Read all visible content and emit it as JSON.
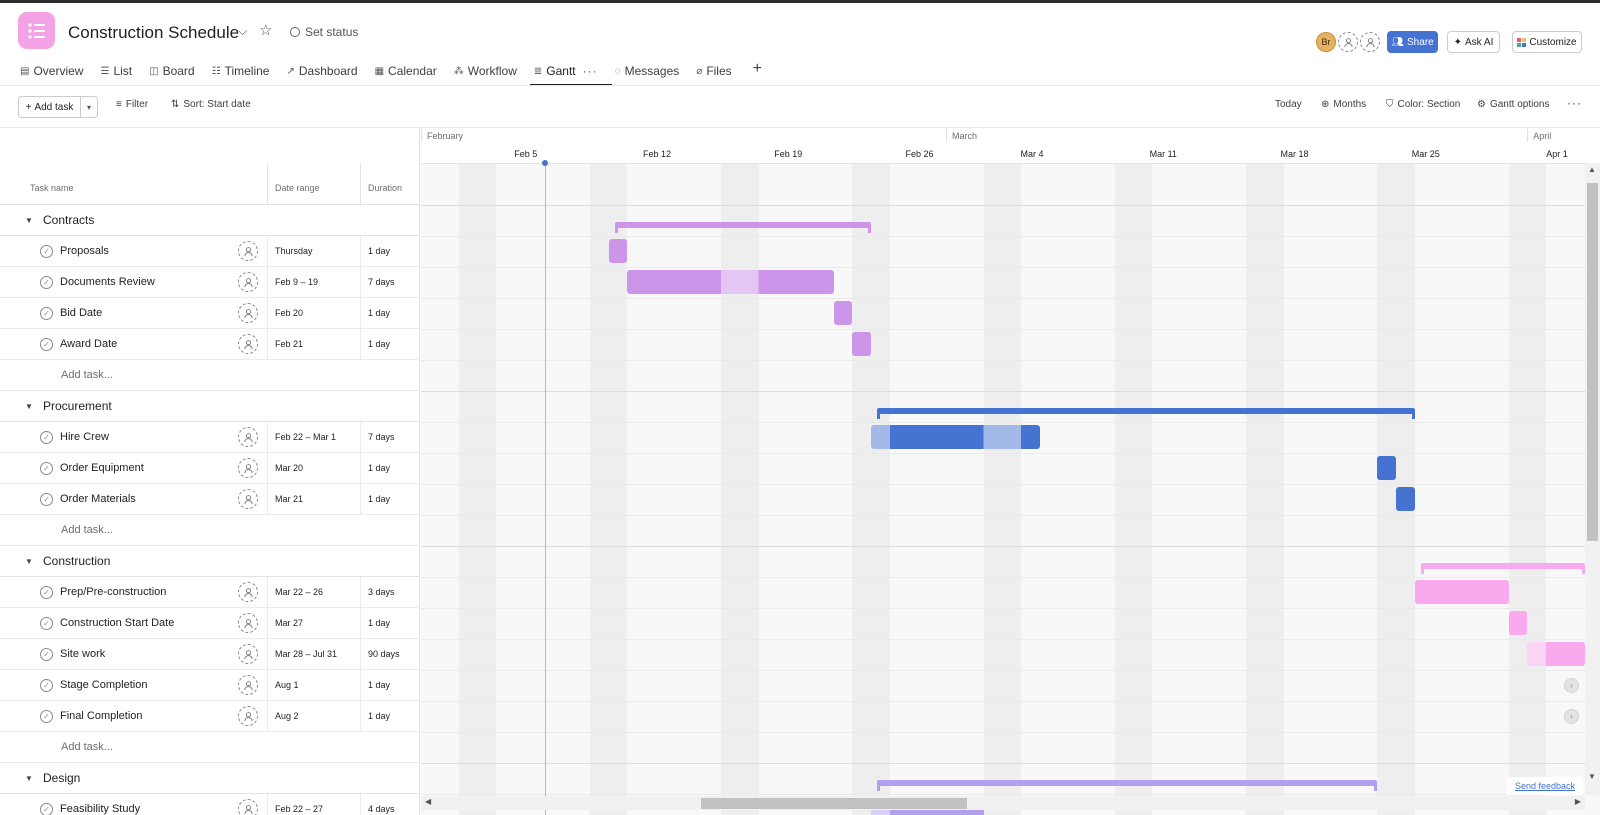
{
  "header": {
    "title": "Construction Schedule",
    "set_status": "Set status",
    "avatar_initials": "Br",
    "share_label": "Share",
    "ask_ai_label": "Ask AI",
    "customize_label": "Customize",
    "brand_color": "#4573d2",
    "project_icon_color": "#f4a2e6"
  },
  "tabs": [
    {
      "label": "Overview",
      "icon": "overview-icon",
      "active": false
    },
    {
      "label": "List",
      "icon": "list-icon",
      "active": false
    },
    {
      "label": "Board",
      "icon": "board-icon",
      "active": false
    },
    {
      "label": "Timeline",
      "icon": "timeline-icon",
      "active": false
    },
    {
      "label": "Dashboard",
      "icon": "dashboard-icon",
      "active": false
    },
    {
      "label": "Calendar",
      "icon": "calendar-icon",
      "active": false
    },
    {
      "label": "Workflow",
      "icon": "workflow-icon",
      "active": false
    },
    {
      "label": "Gantt",
      "icon": "gantt-icon",
      "active": true
    },
    {
      "label": "Messages",
      "icon": "messages-icon",
      "active": false
    },
    {
      "label": "Files",
      "icon": "files-icon",
      "active": false
    }
  ],
  "toolbar": {
    "add_task": "Add task",
    "filter": "Filter",
    "sort": "Sort: Start date",
    "today": "Today",
    "months": "Months",
    "color": "Color: Section",
    "gantt_options": "Gantt options"
  },
  "columns": {
    "task_name": "Task name",
    "date_range": "Date range",
    "duration": "Duration"
  },
  "add_task_label": "Add task...",
  "timeline": {
    "months": [
      {
        "label": "February",
        "day": 0
      },
      {
        "label": "March",
        "day": 28
      },
      {
        "label": "April",
        "day": 59
      }
    ],
    "weeks": [
      "Feb 5",
      "Feb 12",
      "Feb 19",
      "Feb 26",
      "Mar 4",
      "Mar 11",
      "Mar 18",
      "Mar 25",
      "Apr 1"
    ],
    "week_start_days": [
      5,
      12,
      19,
      26,
      32,
      39,
      46,
      53,
      60
    ],
    "today_day": 6
  },
  "sections": [
    {
      "name": "Contracts",
      "color": "#cd95ea",
      "light_color": "#e5c5f3",
      "span": [
        10,
        24
      ],
      "tasks": [
        {
          "name": "Proposals",
          "date": "Thursday",
          "duration": "1 day",
          "start": 10,
          "end": 11
        },
        {
          "name": "Documents Review",
          "date": "Feb 9 – 19",
          "duration": "7 days",
          "start": 11,
          "end": 22
        },
        {
          "name": "Bid Date",
          "date": "Feb 20",
          "duration": "1 day",
          "start": 22,
          "end": 23
        },
        {
          "name": "Award Date",
          "date": "Feb 21",
          "duration": "1 day",
          "start": 23,
          "end": 24
        }
      ]
    },
    {
      "name": "Procurement",
      "color": "#4573d2",
      "light_color": "#a3b9e8",
      "span": [
        24,
        53
      ],
      "tasks": [
        {
          "name": "Hire Crew",
          "date": "Feb 22 – Mar 1",
          "duration": "7 days",
          "start": 24,
          "end": 33
        },
        {
          "name": "Order Equipment",
          "date": "Mar 20",
          "duration": "1 day",
          "start": 51,
          "end": 52
        },
        {
          "name": "Order Materials",
          "date": "Mar 21",
          "duration": "1 day",
          "start": 52,
          "end": 53
        }
      ]
    },
    {
      "name": "Construction",
      "color": "#f9aaef",
      "light_color": "#fbd3f5",
      "span": [
        53,
        200
      ],
      "tasks": [
        {
          "name": "Prep/Pre-construction",
          "date": "Mar 22 – 26",
          "duration": "3 days",
          "start": 53,
          "end": 58
        },
        {
          "name": "Construction Start Date",
          "date": "Mar 27",
          "duration": "1 day",
          "start": 58,
          "end": 59
        },
        {
          "name": "Site work",
          "date": "Mar 28 – Jul 31",
          "duration": "90 days",
          "start": 59,
          "end": 200
        },
        {
          "name": "Stage Completion",
          "date": "Aug 1",
          "duration": "1 day",
          "start": 201,
          "end": 202
        },
        {
          "name": "Final Completion",
          "date": "Aug 2",
          "duration": "1 day",
          "start": 202,
          "end": 203
        }
      ]
    },
    {
      "name": "Design",
      "color": "#b3a0ec",
      "light_color": "#d8cff6",
      "span": [
        24,
        51
      ],
      "tasks": [
        {
          "name": "Feasibility Study",
          "date": "Feb 22 – 27",
          "duration": "4 days",
          "start": 24,
          "end": 30
        }
      ]
    }
  ],
  "send_feedback": "Send feedback"
}
